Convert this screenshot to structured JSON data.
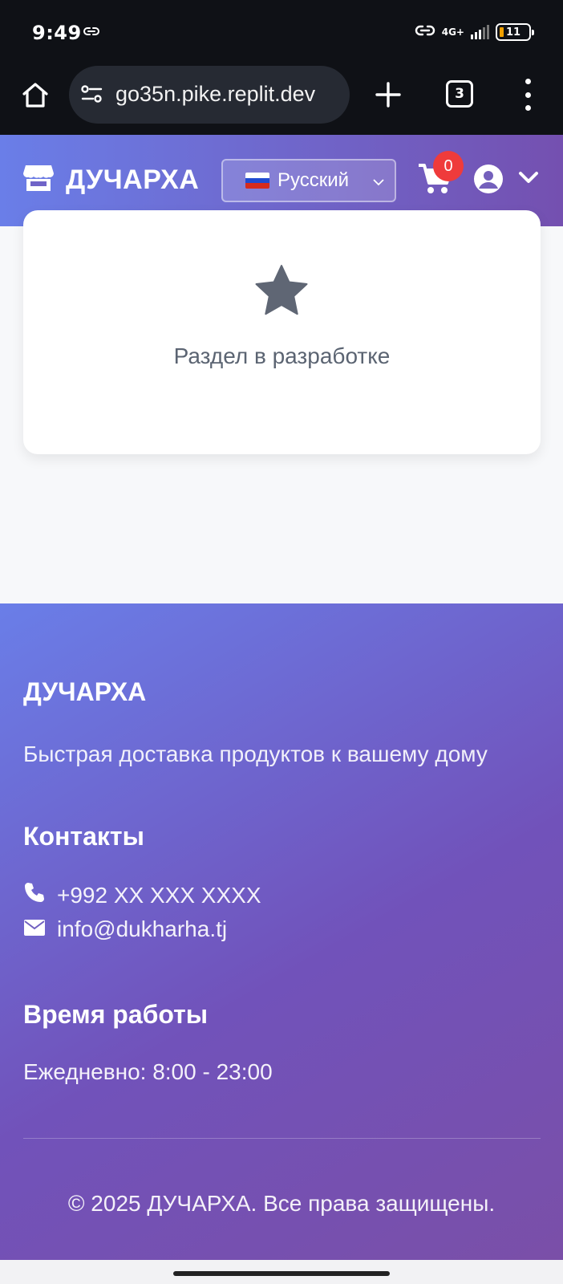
{
  "status_bar": {
    "time": "9:49",
    "network": "4G+",
    "battery": "11"
  },
  "browser": {
    "url": "go35n.pike.replit.dev",
    "tab_count": "3"
  },
  "header": {
    "brand": "ДУЧАРХА",
    "language": {
      "selected": "Русский",
      "flag": "ru"
    },
    "cart_count": "0"
  },
  "card": {
    "message": "Раздел в разработке",
    "icon": "star-icon"
  },
  "footer": {
    "brand": "ДУЧАРХА",
    "tagline": "Быстрая доставка продуктов к вашему дому",
    "contacts_title": "Контакты",
    "phone": "+992 XX XXX XXXX",
    "email": "info@dukharha.tj",
    "hours_title": "Время работы",
    "hours": "Ежедневно: 8:00 - 23:00",
    "copyright": "© 2025 ДУЧАРХА. Все права защищены."
  },
  "colors": {
    "header_gradient_start": "#6a7ee8",
    "header_gradient_end": "#7450b0",
    "badge": "#ef3b3b",
    "muted_text": "#5b6472"
  }
}
